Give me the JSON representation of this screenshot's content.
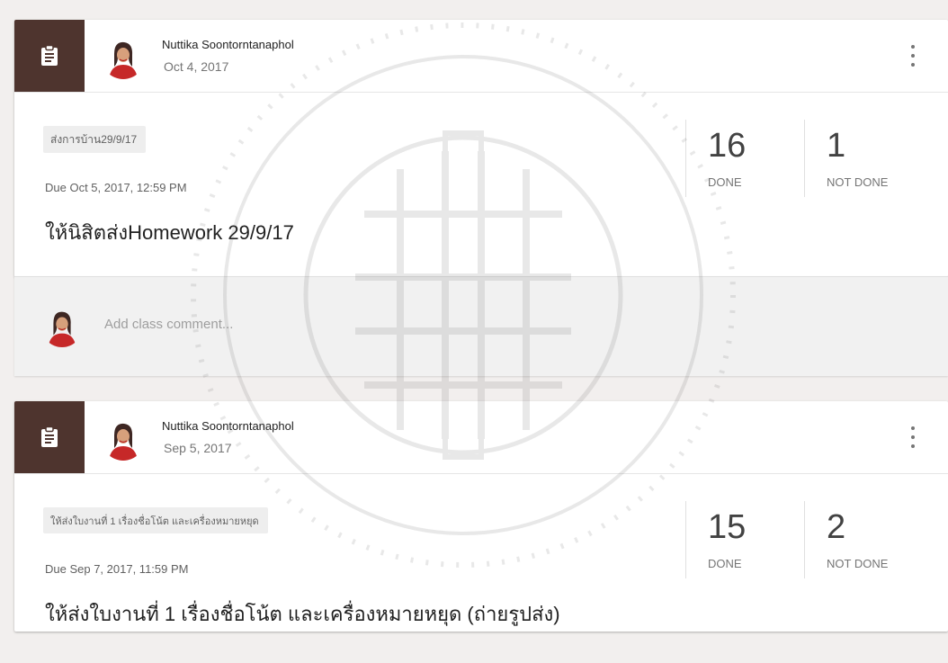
{
  "icons": {
    "assignment": "clipboard-assignment-icon",
    "more": "more-vert-icon"
  },
  "colors": {
    "tile": "#4e342e",
    "page_bg": "#f2efee"
  },
  "posts": [
    {
      "author": "Nuttika Soontorntanaphol",
      "date": "Oct 4, 2017",
      "topic": "ส่งการบ้าน29/9/17",
      "due": "Due Oct 5, 2017, 12:59 PM",
      "title": "ให้นิสิตส่งHomework 29/9/17",
      "done_count": "16",
      "done_label": "DONE",
      "not_done_count": "1",
      "not_done_label": "NOT DONE",
      "comment_placeholder": "Add class comment..."
    },
    {
      "author": "Nuttika Soontorntanaphol",
      "date": "Sep 5, 2017",
      "topic": "ให้ส่งใบงานที่ 1 เรื่องชื่อโน้ต และเครื่องหมายหยุด",
      "due": "Due Sep 7, 2017, 11:59 PM",
      "title": "ให้ส่งใบงานที่ 1 เรื่องชื่อโน้ต และเครื่องหมายหยุด (ถ่ายรูปส่ง)",
      "done_count": "15",
      "done_label": "DONE",
      "not_done_count": "2",
      "not_done_label": "NOT DONE"
    }
  ]
}
